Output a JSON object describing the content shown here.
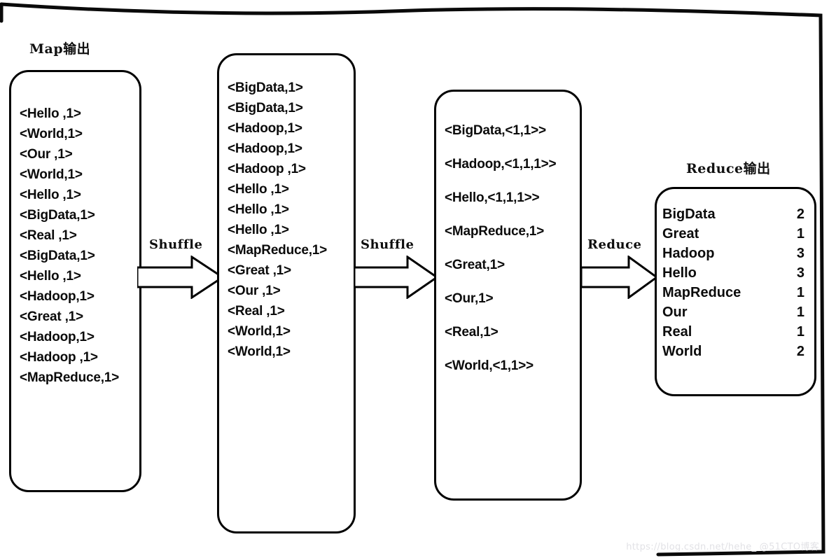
{
  "diagram": {
    "title_map_output": "Map输出",
    "title_reduce_output": "Reduce输出",
    "arrow1_label": "Shuffle",
    "arrow2_label": "Shuffle",
    "arrow3_label": "Reduce",
    "watermark": "https://blog.csdn.net/hehe_ @51CTO博客",
    "ink_color": "#000000",
    "paper_color": "#ffffff"
  },
  "map_output": {
    "lines": [
      "<Hello ,1>",
      "<World,1>",
      "<Our ,1>",
      "<World,1>",
      "",
      "<Hello ,1>",
      "<BigData,1>",
      "<Real ,1>",
      "<BigData,1>",
      "",
      "<Hello ,1>",
      "<Hadoop,1>",
      "<Great ,1>",
      "<Hadoop,1>",
      "",
      "<Hadoop ,1>",
      "<MapReduce,1>"
    ]
  },
  "shuffle_output": {
    "lines": [
      "<BigData,1>",
      "<BigData,1>",
      "",
      "<Hadoop,1>",
      "<Hadoop,1>",
      "<Hadoop ,1>",
      "",
      "<Hello ,1>",
      "<Hello ,1>",
      "<Hello ,1>",
      "",
      "<MapReduce,1>",
      "",
      "<Great ,1>",
      "",
      "<Our ,1>",
      "",
      "<Real ,1>",
      "",
      "<World,1>",
      "<World,1>"
    ]
  },
  "grouped_output": {
    "lines": [
      "<BigData,<1,1>>",
      "<Hadoop,<1,1,1>>",
      "<Hello,<1,1,1>>",
      "<MapReduce,1>",
      "<Great,1>",
      "<Our,1>",
      "<Real,1>",
      "<World,<1,1>>"
    ]
  },
  "reduce_output": {
    "rows": [
      {
        "word": "BigData",
        "count": "2"
      },
      {
        "word": "Great",
        "count": "1"
      },
      {
        "word": "Hadoop",
        "count": "3"
      },
      {
        "word": "Hello",
        "count": "3"
      },
      {
        "word": "MapReduce",
        "count": "1"
      },
      {
        "word": "Our",
        "count": "1"
      },
      {
        "word": "Real",
        "count": "1"
      },
      {
        "word": "World",
        "count": "2"
      }
    ]
  }
}
